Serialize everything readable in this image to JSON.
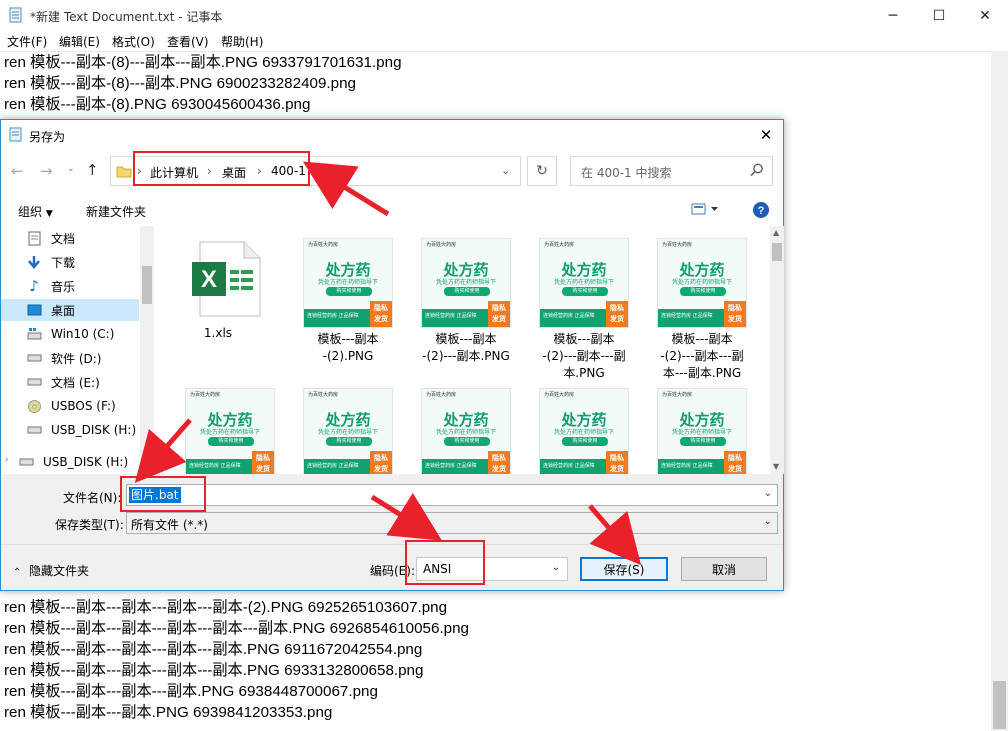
{
  "notepad": {
    "title": "*新建 Text Document.txt - 记事本",
    "menu": [
      "文件(F)",
      "编辑(E)",
      "格式(O)",
      "查看(V)",
      "帮助(H)"
    ],
    "lines_top": [
      "ren 模板---副本-(8)---副本---副本.PNG 6933791701631.png",
      "ren 模板---副本-(8)---副本.PNG 6900233282409.png",
      "ren 模板---副本-(8).PNG 6930045600436.png"
    ],
    "lines_bottom": [
      "ren 模板---副本---副本---副本---副本-(2).PNG 6925265103607.png",
      "ren 模板---副本---副本---副本---副本---副本.PNG 6926854610056.png",
      "ren 模板---副本---副本---副本---副本.PNG 6911672042554.png",
      "ren 模板---副本---副本---副本---副本.PNG 6933132800658.png",
      "ren 模板---副本---副本---副本.PNG 6938448700067.png",
      "ren 模板---副本---副本.PNG 6939841203353.png"
    ]
  },
  "dialog": {
    "title": "另存为",
    "breadcrumb": [
      "此计算机",
      "桌面",
      "400-1"
    ],
    "search_placeholder": "在 400-1 中搜索",
    "toolbar": {
      "organize": "组织",
      "new_folder": "新建文件夹"
    },
    "nav_items": [
      "文档",
      "下载",
      "音乐",
      "桌面",
      "Win10 (C:)",
      "软件 (D:)",
      "文档 (E:)",
      "USBOS (F:)",
      "USB_DISK (H:)",
      "USB_DISK (H:)"
    ],
    "selected_nav": "桌面",
    "files_row1": [
      "1.xls",
      "模板---副本\n-(2).PNG",
      "模板---副本\n-(2)---副本.PNG",
      "模板---副本\n-(2)---副本---副\n本.PNG",
      "模板---副本\n-(2)---副本---副\n本---副本.PNG"
    ],
    "thumb": {
      "brand": "为百姓大药房",
      "big": "处方药",
      "sub": "凭处方药在药师指导下",
      "pill": "购买和使用",
      "bar": "连锁经营药房  正品保障",
      "tag": "隐私\n发货"
    },
    "filename_label": "文件名(N):",
    "filename_value": "图片.bat",
    "filetype_label": "保存类型(T):",
    "filetype_value": "所有文件 (*.*)",
    "hide_folders": "隐藏文件夹",
    "encoding_label": "编码(E):",
    "encoding_value": "ANSI",
    "save": "保存(S)",
    "cancel": "取消"
  },
  "colors": {
    "annotation_red": "#e8212a",
    "selection_blue": "#0078d7",
    "accent_border": "#2a8fd0"
  }
}
